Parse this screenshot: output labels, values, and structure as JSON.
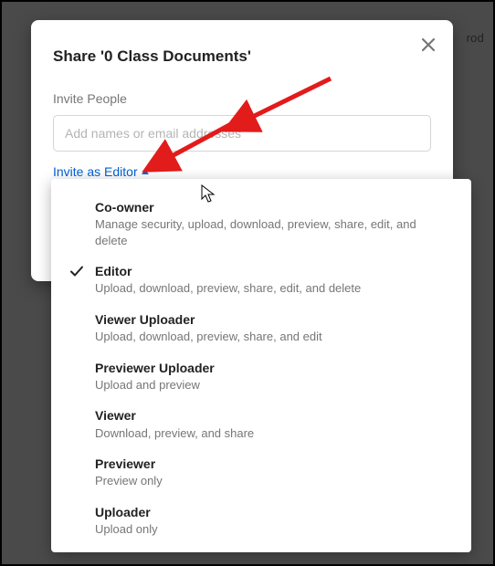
{
  "bg_fragment": "rod",
  "modal": {
    "title": "Share '0 Class Documents'",
    "section_label": "Invite People",
    "input_placeholder": "Add names or email addresses",
    "invite_label": "Invite as Editor"
  },
  "roles": [
    {
      "title": "Co-owner",
      "desc": "Manage security, upload, download, preview, share, edit, and delete",
      "selected": false
    },
    {
      "title": "Editor",
      "desc": "Upload, download, preview, share, edit, and delete",
      "selected": true
    },
    {
      "title": "Viewer Uploader",
      "desc": "Upload, download, preview, share, and edit",
      "selected": false
    },
    {
      "title": "Previewer Uploader",
      "desc": "Upload and preview",
      "selected": false
    },
    {
      "title": "Viewer",
      "desc": "Download, preview, and share",
      "selected": false
    },
    {
      "title": "Previewer",
      "desc": "Preview only",
      "selected": false
    },
    {
      "title": "Uploader",
      "desc": "Upload only",
      "selected": false
    }
  ],
  "annotations": {
    "arrow_color": "#e21b1b"
  }
}
